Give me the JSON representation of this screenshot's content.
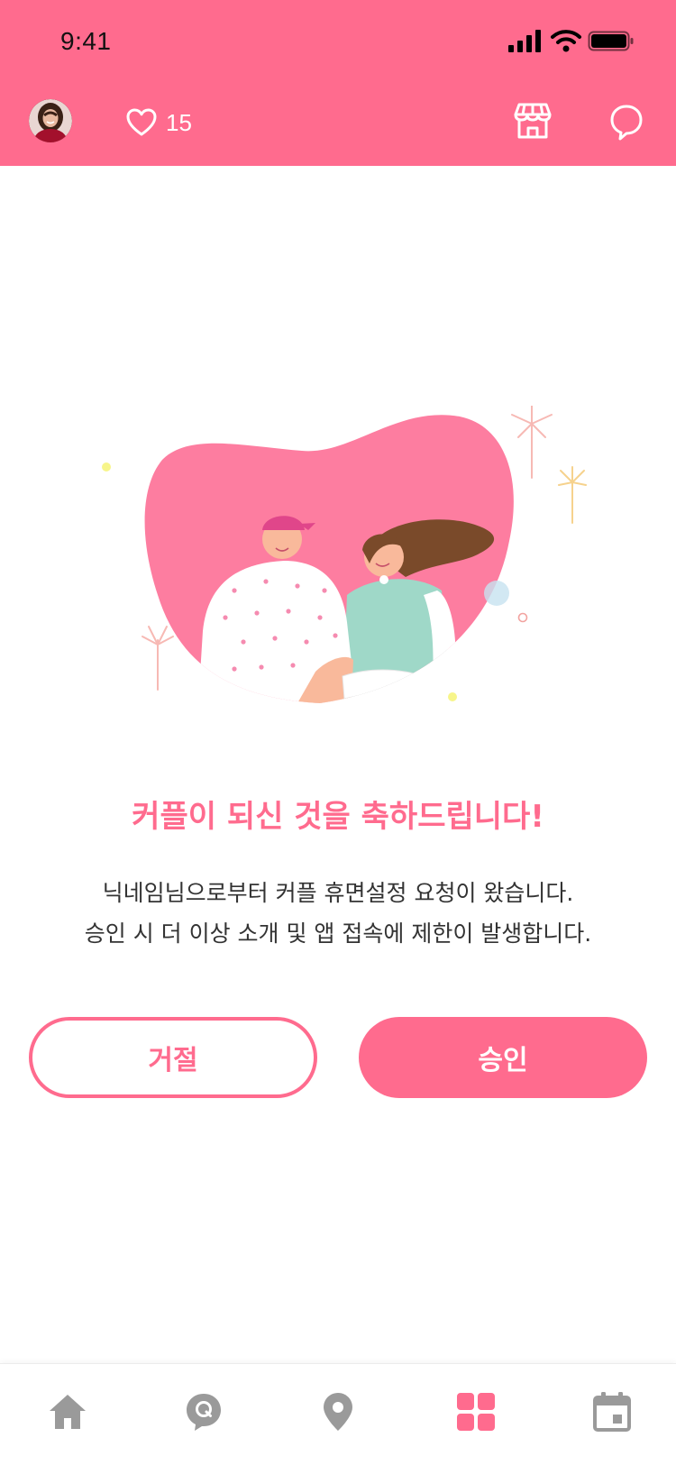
{
  "status_bar": {
    "time": "9:41"
  },
  "header": {
    "heart_count": "15",
    "icons": [
      "heart-icon",
      "store-icon",
      "chat-bubble-icon"
    ],
    "accent_color": "#ff6b8e"
  },
  "main": {
    "headline": "커플이 되신 것을 축하드립니다!",
    "description_line1": "닉네임님으로부터 커플 휴면설정 요청이 왔습니다.",
    "description_line2": "승인 시 더 이상 소개 및 앱 접속에 제한이 발생합니다."
  },
  "actions": {
    "reject_label": "거절",
    "approve_label": "승인"
  },
  "bottom_nav": {
    "items": [
      {
        "icon": "home-icon",
        "active": false
      },
      {
        "icon": "q-chat-icon",
        "active": false
      },
      {
        "icon": "map-pin-icon",
        "active": false
      },
      {
        "icon": "grid-icon",
        "active": true
      },
      {
        "icon": "calendar-icon",
        "active": false
      }
    ],
    "active_color": "#ff6b8e",
    "inactive_color": "#9a9a9a"
  }
}
